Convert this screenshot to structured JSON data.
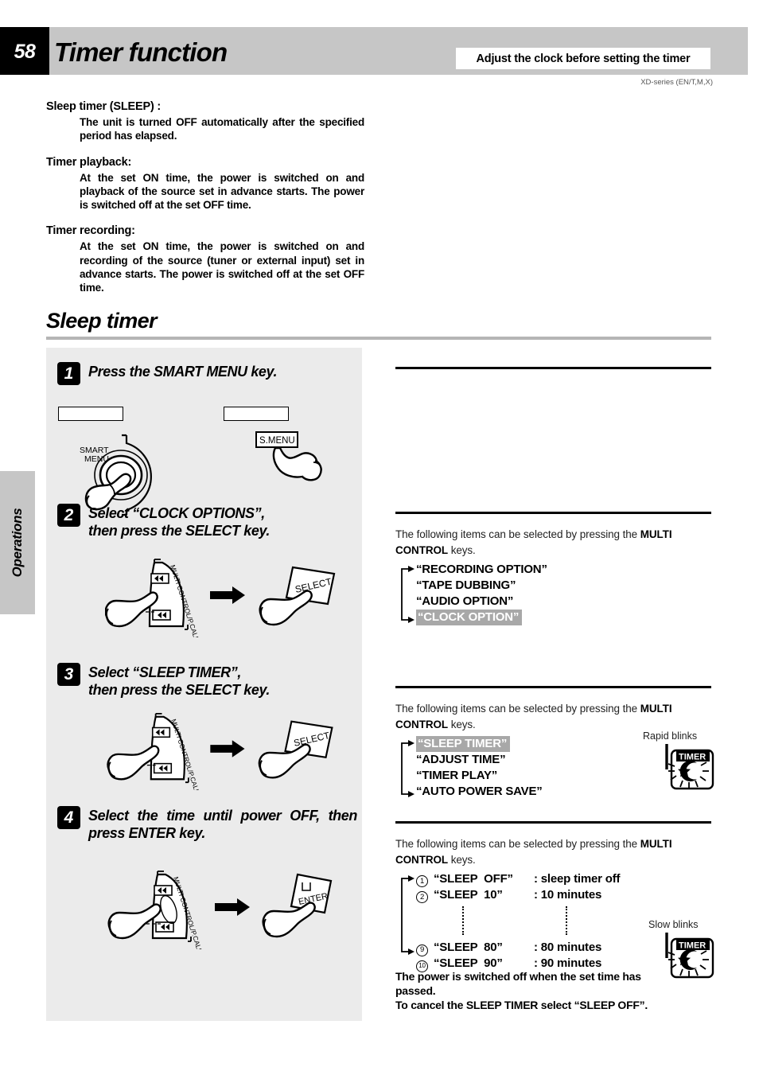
{
  "header": {
    "page_number": "58",
    "title": "Timer function",
    "note": "Adjust the clock before setting the timer",
    "model_line": "XD-series (EN/T,M,X)"
  },
  "sidebar": {
    "tab_label": "Operations"
  },
  "intro": [
    {
      "term": "Sleep timer (SLEEP) :",
      "definition": "The unit is turned OFF automatically after the specified period has elapsed."
    },
    {
      "term": "Timer playback:",
      "definition": "At the set ON time, the power is switched on and playback of the source set in advance starts. The power is switched off at the set OFF time."
    },
    {
      "term": "Timer recording:",
      "definition": "At the set ON time, the power is switched on and recording of the source (tuner or external input) set in advance starts. The power is switched off at the set OFF time."
    }
  ],
  "section": {
    "title": "Sleep timer"
  },
  "steps": [
    {
      "number": "1",
      "line1": "Press the SMART MENU key.",
      "line2": "",
      "unit_knob_label_line1": "SMART",
      "unit_knob_label_line2": "MENU",
      "remote_key_label": "S.MENU"
    },
    {
      "number": "2",
      "line1": "Select “CLOCK OPTIONS”,",
      "line2": "then press the SELECT key.",
      "control_label": "MULTI CONTROL/P.CALL",
      "remote_key_label": "SELECT"
    },
    {
      "number": "3",
      "line1": "Select “SLEEP TIMER”,",
      "line2": "then press the SELECT key.",
      "control_label": "MULTI CONTROL/P.CALL",
      "remote_key_label": "SELECT"
    },
    {
      "number": "4",
      "line1": "Select the time until power OFF, then",
      "line2": "press ENTER key.",
      "control_label": "MULTI CONTROL/P.CALL",
      "remote_key_label": "ENTER"
    }
  ],
  "notes": {
    "lead_a": "The following items can be selected by pressing the ",
    "lead_b": "MULTI CONTROL",
    "lead_c": " keys."
  },
  "clock_options": {
    "items": [
      {
        "label": "“RECORDING OPTION”",
        "highlighted": false
      },
      {
        "label": "“TAPE DUBBING”",
        "highlighted": false
      },
      {
        "label": "“AUDIO OPTION”",
        "highlighted": false
      },
      {
        "label": "“CLOCK OPTION”",
        "highlighted": true
      }
    ]
  },
  "clock_submenu": {
    "items": [
      {
        "label": "“SLEEP TIMER”",
        "highlighted": true
      },
      {
        "label": "“ADJUST TIME”",
        "highlighted": false
      },
      {
        "label": "“TIMER PLAY”",
        "highlighted": false
      },
      {
        "label": "“AUTO POWER SAVE”",
        "highlighted": false
      }
    ],
    "indicator": {
      "caption": "Rapid blinks",
      "label": "TIMER"
    }
  },
  "sleep_values": {
    "rows": [
      {
        "index": "1",
        "name": "“SLEEP  OFF”",
        "desc": ": sleep timer off"
      },
      {
        "index": "2",
        "name": "“SLEEP  10”",
        "desc": ": 10 minutes"
      },
      {
        "index": "9",
        "name": "“SLEEP  80”",
        "desc": ": 80 minutes"
      },
      {
        "index": "10",
        "name": "“SLEEP  90”",
        "desc": ": 90 minutes"
      }
    ],
    "indicator": {
      "caption": "Slow blinks",
      "label": "TIMER"
    }
  },
  "closing": {
    "line1": "The power is switched off when the set time has",
    "line2": "passed.",
    "line3": "To cancel the SLEEP TIMER select “SLEEP OFF”."
  },
  "colors": {
    "header_band": "#c6c6c6",
    "panel": "#ebebeb",
    "highlight": "#a8a8a8",
    "rule": "#000000"
  }
}
